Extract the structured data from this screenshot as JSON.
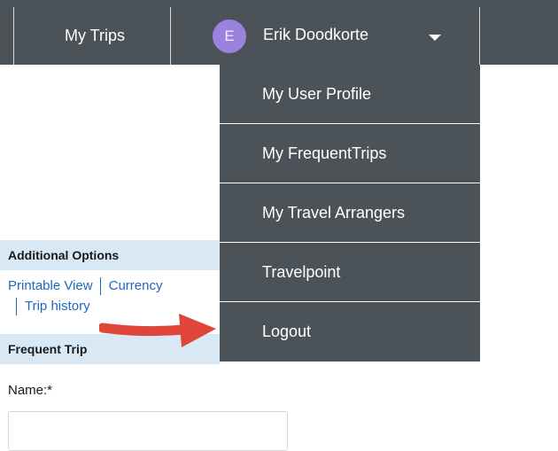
{
  "nav": {
    "my_trips": "My Trips",
    "avatar_initial": "E",
    "user_name": "Erik Doodkorte"
  },
  "dropdown": {
    "items": [
      {
        "label": "My User Profile"
      },
      {
        "label": "My FrequentTrips"
      },
      {
        "label": "My Travel Arrangers"
      },
      {
        "label": "Travelpoint"
      },
      {
        "label": "Logout"
      }
    ]
  },
  "additional_options": {
    "heading": "Additional Options",
    "links": [
      "Printable View",
      "Currency",
      "Trip history"
    ]
  },
  "frequent_trip": {
    "heading": "Frequent Trip",
    "name_label": "Name:*",
    "name_value": ""
  },
  "colors": {
    "nav_bg": "#4b5358",
    "avatar": "#9b82df",
    "section_bg": "#d9e8f5",
    "link": "#1f66c2",
    "arrow": "#e0453a"
  },
  "icons": {
    "caret": "chevron-down-icon",
    "annotation": "red-arrow-icon"
  }
}
